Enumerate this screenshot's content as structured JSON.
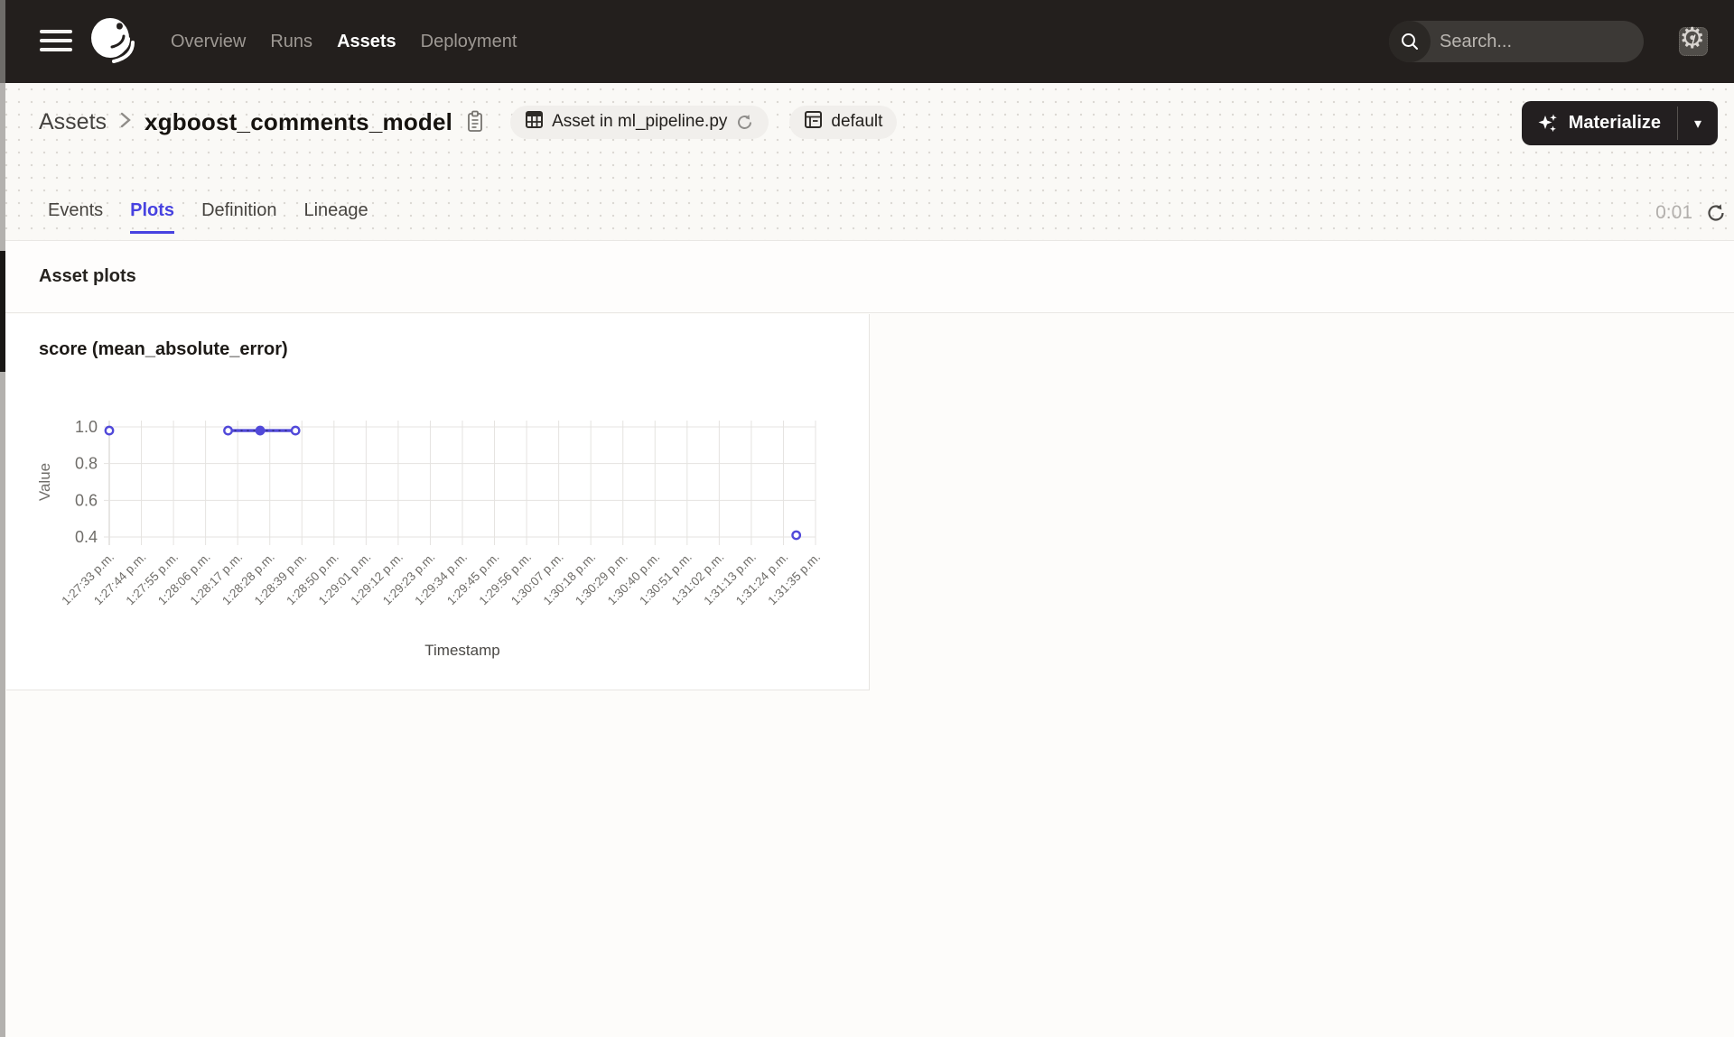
{
  "navbar": {
    "items": [
      {
        "label": "Overview",
        "active": false
      },
      {
        "label": "Runs",
        "active": false
      },
      {
        "label": "Assets",
        "active": true
      },
      {
        "label": "Deployment",
        "active": false
      }
    ],
    "search": {
      "placeholder": "Search...",
      "shortcut": "/"
    },
    "colors": {
      "bg": "#231f1d"
    }
  },
  "header": {
    "breadcrumb_root": "Assets",
    "title": "xgboost_comments_model",
    "chips": [
      {
        "label": "Asset in ml_pipeline.py"
      },
      {
        "label": "default"
      }
    ],
    "materialize_label": "Materialize"
  },
  "tabs": {
    "items": [
      {
        "label": "Events",
        "active": false
      },
      {
        "label": "Plots",
        "active": true
      },
      {
        "label": "Definition",
        "active": false
      },
      {
        "label": "Lineage",
        "active": false
      }
    ],
    "timer": "0:01"
  },
  "section": {
    "title": "Asset plots"
  },
  "chart_data": {
    "type": "line",
    "title": "score (mean_absolute_error)",
    "xlabel": "Timestamp",
    "ylabel": "Value",
    "y_ticks": [
      1.0,
      0.8,
      0.6,
      0.4
    ],
    "ylim": [
      0.4,
      1.0
    ],
    "grid": true,
    "x_tick_labels": [
      "1:27:33 p.m.",
      "1:27:44 p.m.",
      "1:27:55 p.m.",
      "1:28:06 p.m.",
      "1:28:17 p.m.",
      "1:28:28 p.m.",
      "1:28:39 p.m.",
      "1:28:50 p.m.",
      "1:29:01 p.m.",
      "1:29:12 p.m.",
      "1:29:23 p.m.",
      "1:29:34 p.m.",
      "1:29:45 p.m.",
      "1:29:56 p.m.",
      "1:30:07 p.m.",
      "1:30:18 p.m.",
      "1:30:29 p.m.",
      "1:30:40 p.m.",
      "1:30:51 p.m.",
      "1:31:02 p.m.",
      "1:31:13 p.m.",
      "1:31:24 p.m.",
      "1:31:35 p.m."
    ],
    "series": [
      {
        "name": "score (mean_absolute_error)",
        "color": "#5149d9",
        "dotted_overlay_color": "#26235c",
        "points": [
          {
            "x_index": 0,
            "value": 0.98,
            "marker": "open"
          },
          {
            "x_index": 3.7,
            "value": 0.98,
            "marker": "open"
          },
          {
            "x_index": 4.7,
            "value": 0.98,
            "marker": "filled"
          },
          {
            "x_index": 5.8,
            "value": 0.98,
            "marker": "open"
          },
          {
            "x_index": 21.4,
            "value": 0.41,
            "marker": "open"
          }
        ],
        "connected_point_indices": [
          1,
          2,
          3
        ]
      }
    ]
  }
}
